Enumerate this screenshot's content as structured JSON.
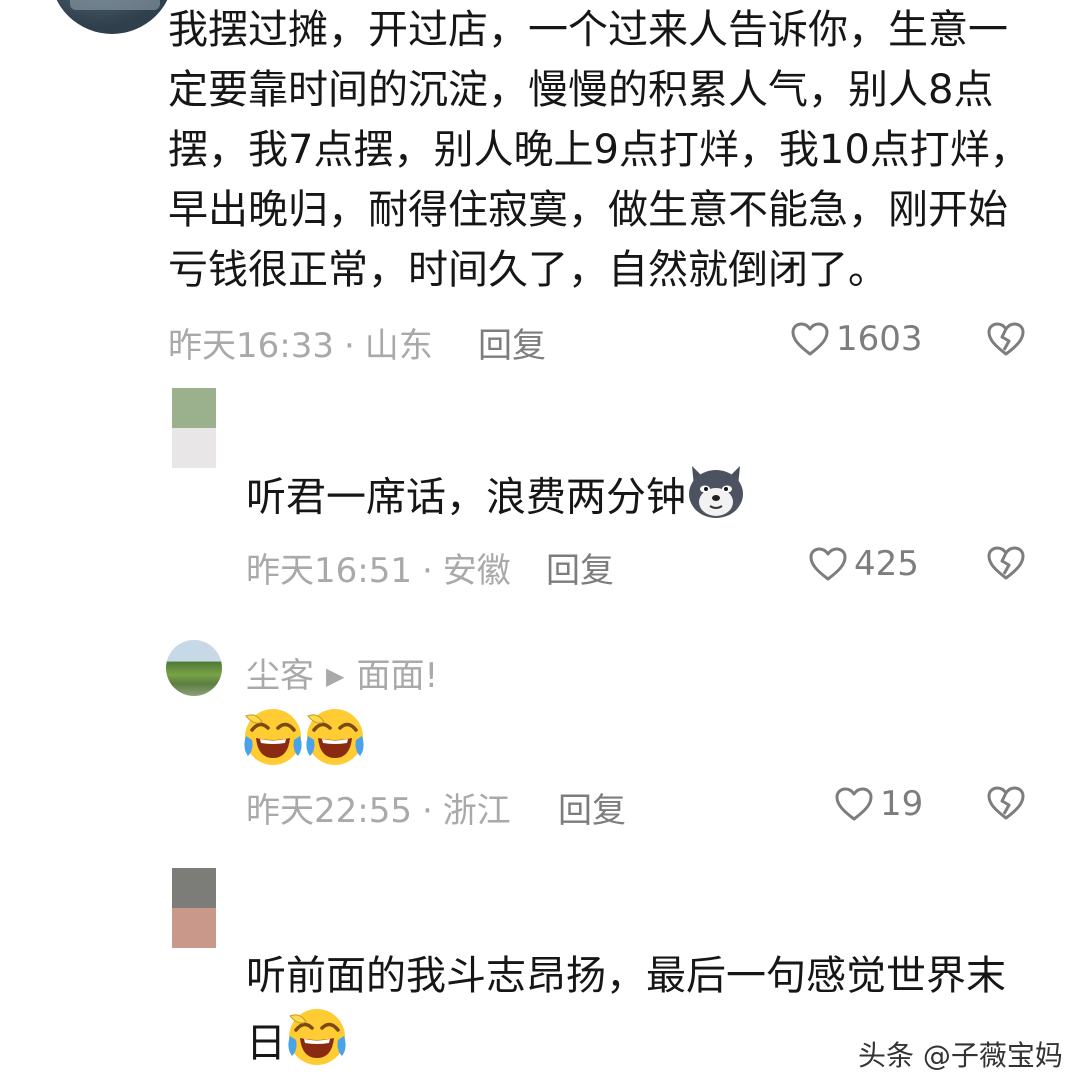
{
  "comments": [
    {
      "text_lines": [
        "我摆过摊，开过店，一个过来人告诉你，生意一",
        "定要靠时间的沉淀，慢慢的积累人气，别人8点",
        "摆，我7点摆，别人晚上9点打烊，我10点打烊，",
        "早出晚归，耐得住寂寞，做生意不能急，刚开始",
        "亏钱很正常，时间久了，自然就倒闭了。"
      ],
      "time": "昨天16:33",
      "dot": "·",
      "location": "山东",
      "reply": "回复",
      "likes": "1603"
    },
    {
      "text": "听君一席话，浪费两分钟",
      "time": "昨天16:51",
      "dot": "·",
      "location": "安徽",
      "reply": "回复",
      "likes": "425"
    },
    {
      "username": "尘客",
      "arrow": "▶",
      "reply_to": "面面!",
      "time": "昨天22:55",
      "dot": "·",
      "location": "浙江",
      "reply": "回复",
      "likes": "19"
    },
    {
      "text_lines": [
        "听前面的我斗志昂扬，最后一句感觉世界末",
        "日"
      ]
    }
  ],
  "watermark": "头条 @子薇宝妈",
  "colors": {
    "text": "#161616",
    "meta": "#a9a9a9",
    "secondary": "#7d7d7d",
    "background": "#ffffff"
  },
  "icons": [
    "heart-outline-icon",
    "broken-heart-icon",
    "laughing-crying-emoji",
    "wolf-emoji"
  ]
}
